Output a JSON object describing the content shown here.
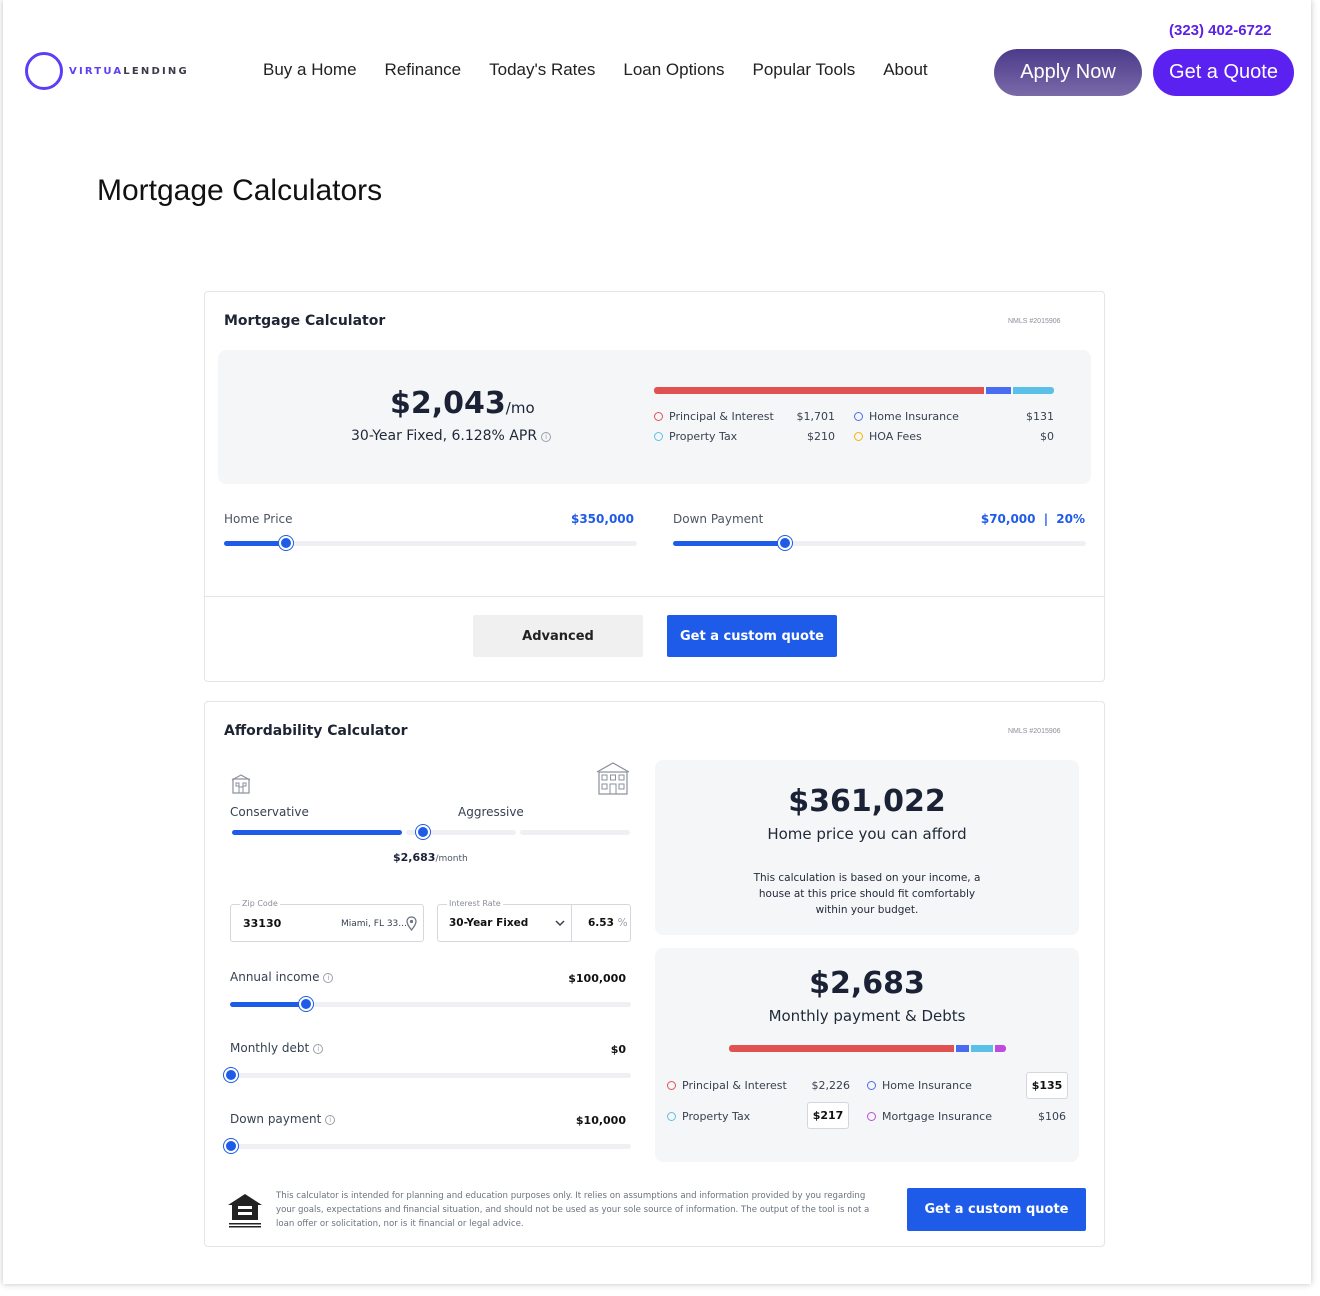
{
  "header": {
    "logo_text_a": "VIRTUA",
    "logo_text_b": "LENDING",
    "phone": "(323) 402-6722",
    "nav": [
      "Buy a Home",
      "Refinance",
      "Today's Rates",
      "Loan Options",
      "Popular Tools",
      "About"
    ],
    "apply_label": "Apply Now",
    "quote_label": "Get a Quote"
  },
  "page_title": "Mortgage Calculators",
  "mortgage": {
    "title": "Mortgage Calculator",
    "nmls": "NMLS #2015906",
    "payment": "$2,043",
    "per": "/mo",
    "loan_desc": "30-Year Fixed, 6.128% APR",
    "breakdown": [
      {
        "label": "Principal & Interest",
        "value": "$1,701",
        "color": "#e05252"
      },
      {
        "label": "Home Insurance",
        "value": "$131",
        "color": "#4a6cf0"
      },
      {
        "label": "Property Tax",
        "value": "$210",
        "color": "#5bc0e8"
      },
      {
        "label": "HOA Fees",
        "value": "$0",
        "color": "#f5b400"
      }
    ],
    "home_price_label": "Home Price",
    "home_price_value": "$350,000",
    "home_price_level": 0.15,
    "down_payment_label": "Down Payment",
    "down_payment_value": "$70,000",
    "down_payment_pct": "20%",
    "down_payment_level": 0.27,
    "advanced_label": "Advanced",
    "custom_quote_label": "Get a custom quote"
  },
  "afford": {
    "title": "Affordability Calculator",
    "nmls": "NMLS #2015906",
    "conservative": "Conservative",
    "aggressive": "Aggressive",
    "monthly": "$2,683",
    "monthly_unit": "/month",
    "zip_legend": "Zip Code",
    "zip_value": "33130",
    "zip_city": "Miami, FL 33...",
    "rate_legend": "Interest Rate",
    "rate_type": "30-Year Fixed",
    "rate_value": "6.53",
    "rate_unit": "%",
    "income_label": "Annual income",
    "income_value": "$100,000",
    "debt_label": "Monthly debt",
    "debt_value": "$0",
    "down_label": "Down payment",
    "down_value": "$10,000",
    "afford_value": "$361,022",
    "afford_caption": "Home price you can afford",
    "afford_note": "This calculation is based on your income, a house at this price should fit comfortably within your budget.",
    "monthly_total": "$2,683",
    "monthly_caption": "Monthly payment & Debts",
    "breakdown": [
      {
        "label": "Principal & Interest",
        "value": "$2,226",
        "color": "#e05252"
      },
      {
        "label": "Home Insurance",
        "value": "$135",
        "color": "#4a6cf0"
      },
      {
        "label": "Property Tax",
        "value": "$217",
        "color": "#5bc0e8"
      },
      {
        "label": "Mortgage Insurance",
        "value": "$106",
        "color": "#c04ae0"
      }
    ],
    "disclaimer": "This calculator is intended for planning and education purposes only. It relies on assumptions and information provided by you regarding your goals, expectations and financial situation, and should not be used as your sole source of information. The output of the tool is not a loan offer or solicitation, nor is it financial or legal advice.",
    "custom_quote_label": "Get a custom quote"
  }
}
